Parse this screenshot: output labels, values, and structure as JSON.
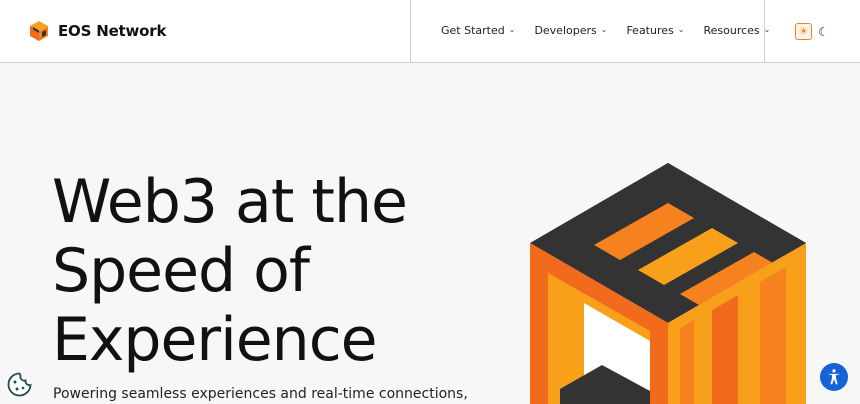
{
  "brand": {
    "name": "EOS Network",
    "logo_icon": "eos-cube-logo-icon"
  },
  "nav": {
    "items": [
      {
        "label": "Get Started",
        "icon": "chevron-down-icon"
      },
      {
        "label": "Developers",
        "icon": "chevron-down-icon"
      },
      {
        "label": "Features",
        "icon": "chevron-down-icon"
      },
      {
        "label": "Resources",
        "icon": "chevron-down-icon"
      }
    ]
  },
  "theme_toggle": {
    "light_icon": "sun-icon",
    "dark_icon": "moon-icon",
    "selected": "light"
  },
  "hero": {
    "title_lines": [
      "Web3 at the",
      "Speed of",
      "Experience"
    ],
    "subtitle": "Powering seamless experiences and real-time connections,"
  },
  "floating": {
    "cookie_icon": "cookie-icon",
    "accessibility_icon": "accessibility-icon"
  },
  "colors": {
    "accent": "#f5821f",
    "accent_light": "#f9a01b",
    "dark": "#333333",
    "accessibility_blue": "#1463d8"
  }
}
